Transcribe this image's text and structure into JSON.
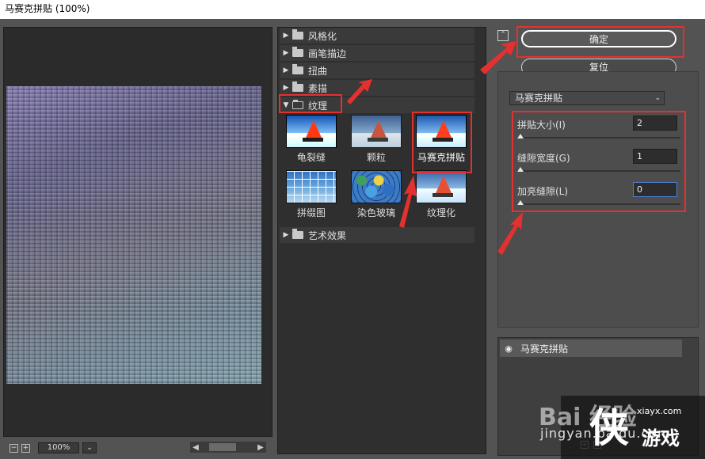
{
  "window": {
    "title": "马赛克拼贴 (100%)"
  },
  "preview": {
    "zoom": "100%"
  },
  "filter_categories": [
    {
      "label": "风格化",
      "expanded": false
    },
    {
      "label": "画笔描边",
      "expanded": false
    },
    {
      "label": "扭曲",
      "expanded": false
    },
    {
      "label": "素描",
      "expanded": false
    },
    {
      "label": "纹理",
      "expanded": true
    },
    {
      "label": "艺术效果",
      "expanded": false
    }
  ],
  "texture_filters": [
    {
      "label": "龟裂缝",
      "selected": false
    },
    {
      "label": "颗粒",
      "selected": false
    },
    {
      "label": "马赛克拼贴",
      "selected": true
    },
    {
      "label": "拼缀图",
      "selected": false
    },
    {
      "label": "染色玻璃",
      "selected": false
    },
    {
      "label": "纹理化",
      "selected": false
    }
  ],
  "buttons": {
    "ok": "确定",
    "reset": "复位"
  },
  "settings": {
    "filter_name": "马赛克拼贴",
    "params": [
      {
        "label": "拼贴大小(I)",
        "value": "2"
      },
      {
        "label": "缝隙宽度(G)",
        "value": "1"
      },
      {
        "label": "加亮缝隙(L)",
        "value": "0"
      }
    ]
  },
  "layers": {
    "items": [
      {
        "label": "马赛克拼贴"
      }
    ]
  },
  "watermark": {
    "site": "xiayx.com",
    "game": "游戏",
    "url": "jingyan.baidu.com",
    "brand": "Bai 经验"
  },
  "colors": {
    "annotation": "#e53030",
    "panel_bg": "#535353",
    "accent": "#4a82d8"
  }
}
